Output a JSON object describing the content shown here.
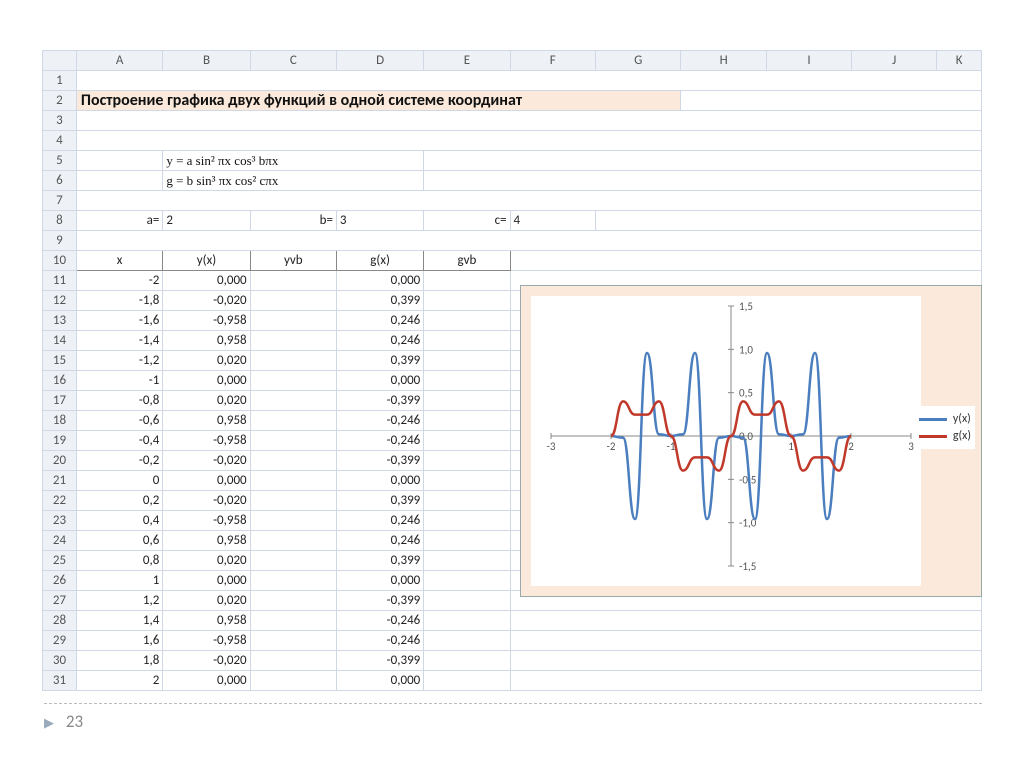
{
  "title": "Построение графика двух функций в одной системе координат",
  "formulas": {
    "y": "y = a sin² πx cos³ bπx",
    "g": "g = b sin³ πx cos² cπx"
  },
  "params": {
    "a_label": "a=",
    "a_val": "2",
    "b_label": "b=",
    "b_val": "3",
    "c_label": "c=",
    "c_val": "4"
  },
  "columns": [
    "A",
    "B",
    "C",
    "D",
    "E",
    "F",
    "G",
    "H",
    "I",
    "J",
    "K"
  ],
  "row_numbers": [
    1,
    2,
    3,
    4,
    5,
    6,
    7,
    8,
    9,
    10,
    11,
    12,
    13,
    14,
    15,
    16,
    17,
    18,
    19,
    20,
    21,
    22,
    23,
    24,
    25,
    26,
    27,
    28,
    29,
    30,
    31
  ],
  "table_headers": {
    "x": "x",
    "yx": "y(x)",
    "yvb": "yvb",
    "gx": "g(x)",
    "gvb": "gvb"
  },
  "table_rows": [
    {
      "x": "-2",
      "yx": "0,000",
      "gx": "0,000"
    },
    {
      "x": "-1,8",
      "yx": "-0,020",
      "gx": "0,399"
    },
    {
      "x": "-1,6",
      "yx": "-0,958",
      "gx": "0,246"
    },
    {
      "x": "-1,4",
      "yx": "0,958",
      "gx": "0,246"
    },
    {
      "x": "-1,2",
      "yx": "0,020",
      "gx": "0,399"
    },
    {
      "x": "-1",
      "yx": "0,000",
      "gx": "0,000"
    },
    {
      "x": "-0,8",
      "yx": "0,020",
      "gx": "-0,399"
    },
    {
      "x": "-0,6",
      "yx": "0,958",
      "gx": "-0,246"
    },
    {
      "x": "-0,4",
      "yx": "-0,958",
      "gx": "-0,246"
    },
    {
      "x": "-0,2",
      "yx": "-0,020",
      "gx": "-0,399"
    },
    {
      "x": "0",
      "yx": "0,000",
      "gx": "0,000"
    },
    {
      "x": "0,2",
      "yx": "-0,020",
      "gx": "0,399"
    },
    {
      "x": "0,4",
      "yx": "-0,958",
      "gx": "0,246"
    },
    {
      "x": "0,6",
      "yx": "0,958",
      "gx": "0,246"
    },
    {
      "x": "0,8",
      "yx": "0,020",
      "gx": "0,399"
    },
    {
      "x": "1",
      "yx": "0,000",
      "gx": "0,000"
    },
    {
      "x": "1,2",
      "yx": "0,020",
      "gx": "-0,399"
    },
    {
      "x": "1,4",
      "yx": "0,958",
      "gx": "-0,246"
    },
    {
      "x": "1,6",
      "yx": "-0,958",
      "gx": "-0,246"
    },
    {
      "x": "1,8",
      "yx": "-0,020",
      "gx": "-0,399"
    },
    {
      "x": "2",
      "yx": "0,000",
      "gx": "0,000"
    }
  ],
  "page_number": "23",
  "chart_data": {
    "type": "line",
    "title": "",
    "xlabel": "",
    "ylabel": "",
    "xlim": [
      -3,
      3
    ],
    "ylim": [
      -1.5,
      1.5
    ],
    "x_ticks": [
      -3,
      -2,
      -1,
      0,
      1,
      2,
      3
    ],
    "y_ticks": [
      -1.5,
      -1.0,
      -0.5,
      0.0,
      0.5,
      1.0,
      1.5
    ],
    "x": [
      -2,
      -1.8,
      -1.6,
      -1.4,
      -1.2,
      -1,
      -0.8,
      -0.6,
      -0.4,
      -0.2,
      0,
      0.2,
      0.4,
      0.6,
      0.8,
      1,
      1.2,
      1.4,
      1.6,
      1.8,
      2
    ],
    "series": [
      {
        "name": "y(x)",
        "color": "#4a7ebf",
        "values": [
          0,
          -0.02,
          -0.958,
          0.958,
          0.02,
          0,
          0.02,
          0.958,
          -0.958,
          -0.02,
          0,
          -0.02,
          -0.958,
          0.958,
          0.02,
          0,
          0.02,
          0.958,
          -0.958,
          -0.02,
          0
        ]
      },
      {
        "name": "g(x)",
        "color": "#c0392b",
        "values": [
          0,
          0.399,
          0.246,
          0.246,
          0.399,
          0,
          -0.399,
          -0.246,
          -0.246,
          -0.399,
          0,
          0.399,
          0.246,
          0.246,
          0.399,
          0,
          -0.399,
          -0.246,
          -0.246,
          -0.399,
          0
        ]
      }
    ],
    "legend": [
      "y(x)",
      "g(x)"
    ],
    "legend_position": "right"
  }
}
